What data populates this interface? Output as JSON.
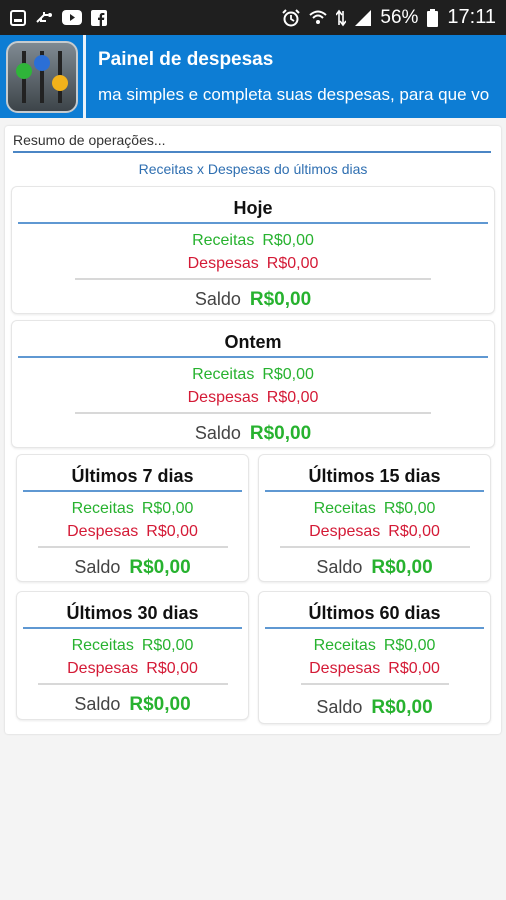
{
  "status_bar": {
    "battery": "56%",
    "time": "17:11",
    "icons_left": [
      "gallery-icon",
      "usb-icon",
      "youtube-icon",
      "facebook-icon"
    ],
    "icons_right": [
      "alarm-icon",
      "wifi-icon",
      "data-arrows-icon",
      "signal-icon",
      "battery-icon"
    ]
  },
  "header": {
    "title": "Painel de despesas",
    "marquee": "ma simples e completa suas despesas, para que vo",
    "accent_color": "#0d7dd4"
  },
  "summary": {
    "heading": "Resumo de operações...",
    "subtitle": "Receitas x Despesas do últimos dias"
  },
  "cards": [
    {
      "title": "Hoje",
      "receitas_label": "Receitas",
      "receitas_value": "R$0,00",
      "despesas_label": "Despesas",
      "despesas_value": "R$0,00",
      "saldo_label": "Saldo",
      "saldo_value": "R$0,00"
    },
    {
      "title": "Ontem",
      "receitas_label": "Receitas",
      "receitas_value": "R$0,00",
      "despesas_label": "Despesas",
      "despesas_value": "R$0,00",
      "saldo_label": "Saldo",
      "saldo_value": "R$0,00"
    },
    {
      "title": "Últimos 7 dias",
      "receitas_label": "Receitas",
      "receitas_value": "R$0,00",
      "despesas_label": "Despesas",
      "despesas_value": "R$0,00",
      "saldo_label": "Saldo",
      "saldo_value": "R$0,00"
    },
    {
      "title": "Últimos 15 dias",
      "receitas_label": "Receitas",
      "receitas_value": "R$0,00",
      "despesas_label": "Despesas",
      "despesas_value": "R$0,00",
      "saldo_label": "Saldo",
      "saldo_value": "R$0,00"
    },
    {
      "title": "Últimos 30 dias",
      "receitas_label": "Receitas",
      "receitas_value": "R$0,00",
      "despesas_label": "Despesas",
      "despesas_value": "R$0,00",
      "saldo_label": "Saldo",
      "saldo_value": "R$0,00"
    },
    {
      "title": "Últimos 60 dias",
      "receitas_label": "Receitas",
      "receitas_value": "R$0,00",
      "despesas_label": "Despesas",
      "despesas_value": "R$0,00",
      "saldo_label": "Saldo",
      "saldo_value": "R$0,00"
    }
  ],
  "colors": {
    "receitas": "#27b22f",
    "despesas": "#d41a36",
    "saldo_positive": "#27b22f",
    "divider_blue": "#5f98d2"
  }
}
